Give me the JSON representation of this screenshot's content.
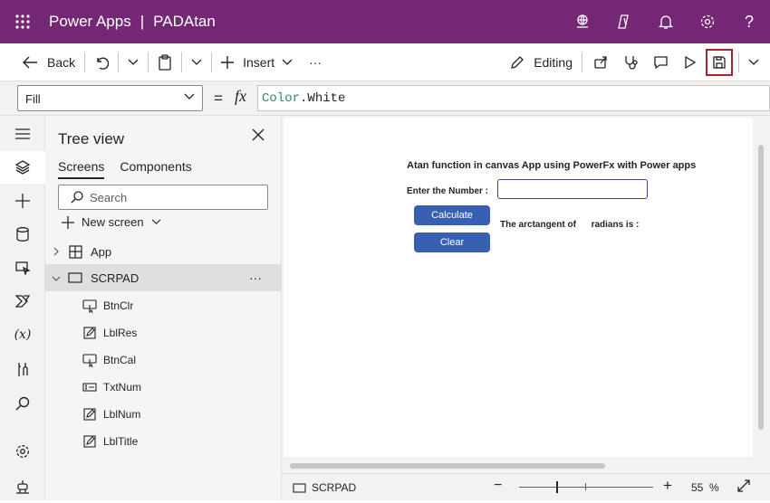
{
  "titlebar": {
    "app_name": "Power Apps",
    "separator": "|",
    "app_title": "PADAtan",
    "icons": [
      "waffle-icon",
      "environment-icon",
      "copilot-icon",
      "bell-icon",
      "gear-icon",
      "help-icon"
    ],
    "help_label": "?"
  },
  "commandbar": {
    "back_label": "Back",
    "insert_label": "Insert",
    "more_label": "···",
    "editing_label": "Editing",
    "accent_save_border": "#a4262c"
  },
  "formula_bar": {
    "property": "Fill",
    "equals": "=",
    "fx": "fx",
    "formula_object": "Color",
    "formula_property": ".White"
  },
  "tree_view": {
    "title": "Tree view",
    "tabs": [
      "Screens",
      "Components"
    ],
    "active_tab": "Screens",
    "search_placeholder": "Search",
    "new_screen_label": "New screen",
    "app_item": "App",
    "screen_item": "SCRPAD",
    "screen_more": "···",
    "children": [
      {
        "name": "BtnClr",
        "icon": "button-icon"
      },
      {
        "name": "LblRes",
        "icon": "label-icon"
      },
      {
        "name": "BtnCal",
        "icon": "button-icon"
      },
      {
        "name": "TxtNum",
        "icon": "textinput-icon"
      },
      {
        "name": "LblNum",
        "icon": "label-icon"
      },
      {
        "name": "LblTitle",
        "icon": "label-icon"
      }
    ]
  },
  "canvas": {
    "title_label": "Atan function in canvas App using PowerFx with Power apps",
    "number_label": "Enter the Number :",
    "calculate_button": "Calculate",
    "clear_button": "Clear",
    "result_label": "The arctangent of      radians is :",
    "button_color": "#3860b2"
  },
  "statusbar": {
    "screen_name": "SCRPAD",
    "zoom_minus": "−",
    "zoom_plus": "+",
    "zoom_value": "55",
    "zoom_unit": "%"
  },
  "colors": {
    "titlebar": "#742774",
    "panel": "#f3f2f1"
  }
}
